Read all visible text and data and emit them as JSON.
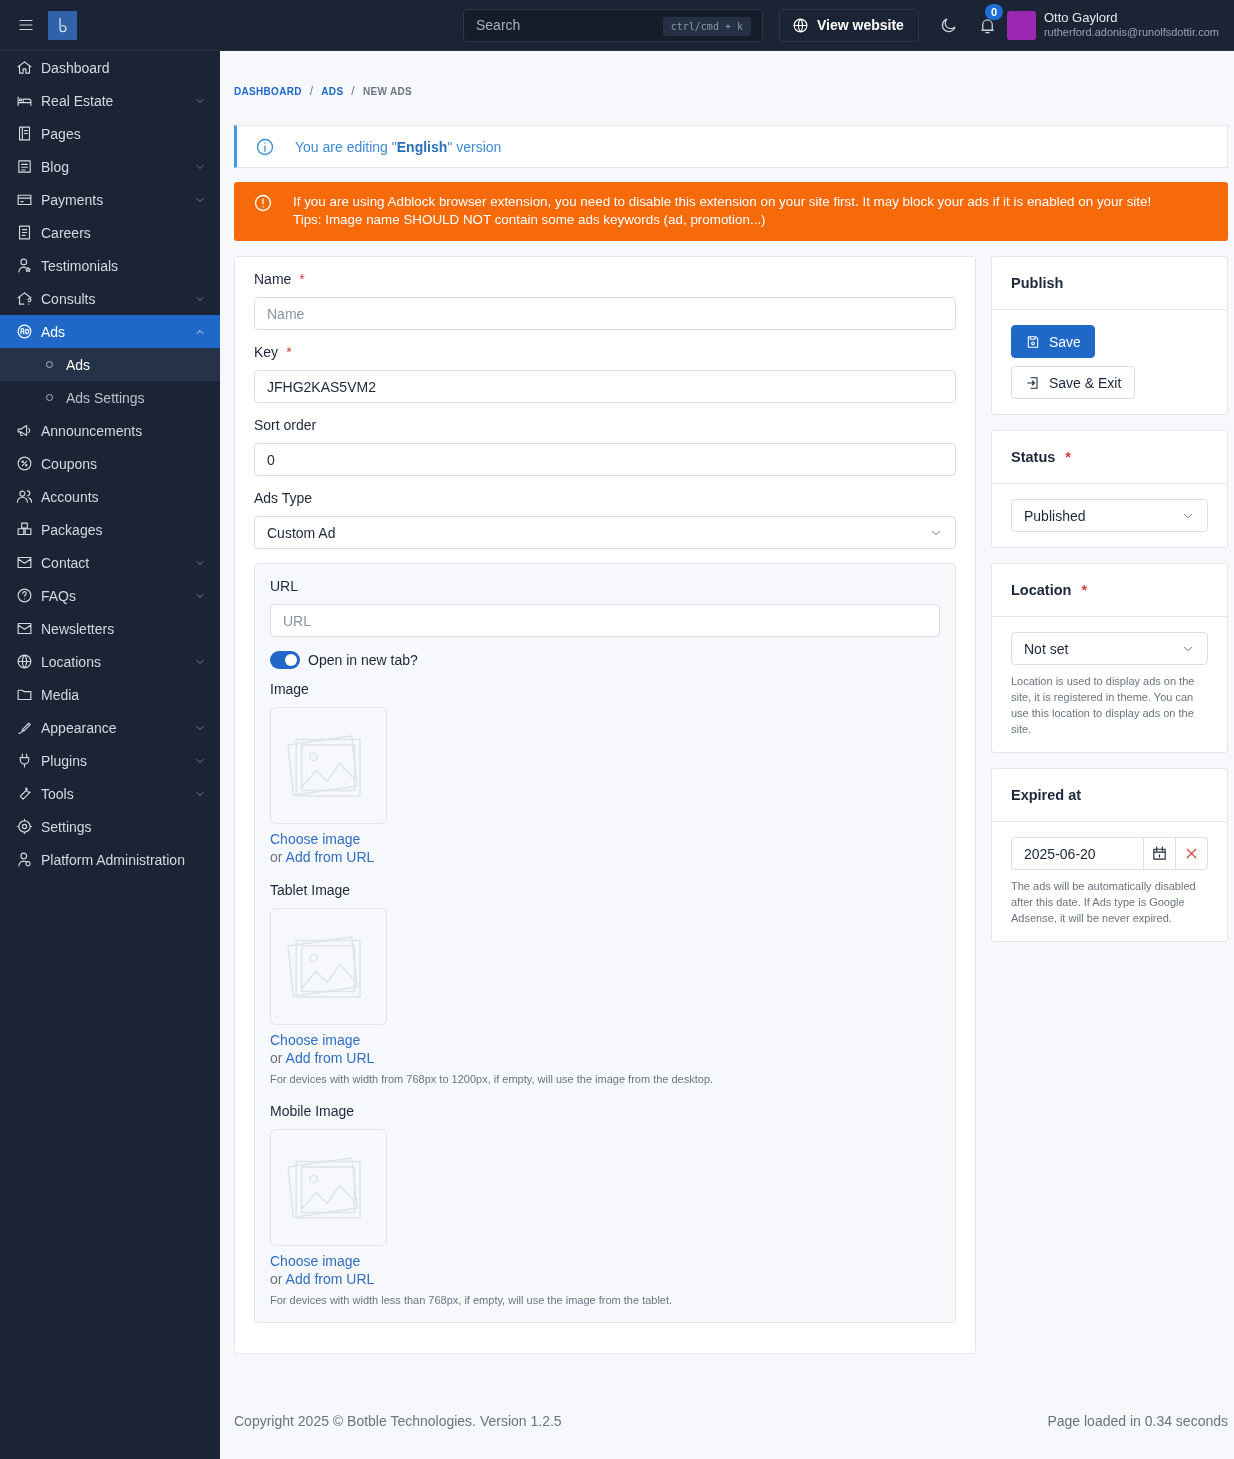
{
  "header": {
    "search": {
      "placeholder": "Search",
      "shortcut": "ctrl/cmd + k"
    },
    "view_website": "View website",
    "notifications": "0",
    "user": {
      "name": "Otto Gaylord",
      "email": "rutherford.adonis@runolfsdottir.com"
    }
  },
  "sidebar": {
    "items": [
      {
        "label": "Dashboard",
        "expandable": false,
        "selected": false
      },
      {
        "label": "Real Estate",
        "expandable": true,
        "expanded": false,
        "selected": false
      },
      {
        "label": "Pages",
        "expandable": false,
        "selected": false
      },
      {
        "label": "Blog",
        "expandable": true,
        "expanded": false,
        "selected": false
      },
      {
        "label": "Payments",
        "expandable": true,
        "expanded": false,
        "selected": false
      },
      {
        "label": "Careers",
        "expandable": false,
        "selected": false
      },
      {
        "label": "Testimonials",
        "expandable": false,
        "selected": false
      },
      {
        "label": "Consults",
        "expandable": true,
        "expanded": false,
        "selected": false
      },
      {
        "label": "Ads",
        "expandable": true,
        "expanded": true,
        "selected": true,
        "children": [
          {
            "label": "Ads",
            "selected": true
          },
          {
            "label": "Ads Settings",
            "selected": false
          }
        ]
      },
      {
        "label": "Announcements",
        "expandable": false,
        "selected": false
      },
      {
        "label": "Coupons",
        "expandable": false,
        "selected": false
      },
      {
        "label": "Accounts",
        "expandable": false,
        "selected": false
      },
      {
        "label": "Packages",
        "expandable": false,
        "selected": false
      },
      {
        "label": "Contact",
        "expandable": true,
        "expanded": false,
        "selected": false
      },
      {
        "label": "FAQs",
        "expandable": true,
        "expanded": false,
        "selected": false
      },
      {
        "label": "Newsletters",
        "expandable": false,
        "selected": false
      },
      {
        "label": "Locations",
        "expandable": true,
        "expanded": false,
        "selected": false
      },
      {
        "label": "Media",
        "expandable": false,
        "selected": false
      },
      {
        "label": "Appearance",
        "expandable": true,
        "expanded": false,
        "selected": false
      },
      {
        "label": "Plugins",
        "expandable": true,
        "expanded": false,
        "selected": false
      },
      {
        "label": "Tools",
        "expandable": true,
        "expanded": false,
        "selected": false
      },
      {
        "label": "Settings",
        "expandable": false,
        "selected": false
      },
      {
        "label": "Platform Administration",
        "expandable": false,
        "selected": false
      }
    ]
  },
  "breadcrumb": {
    "separator": "/",
    "items": [
      {
        "label": "DASHBOARD",
        "link": true
      },
      {
        "label": "ADS",
        "link": true
      },
      {
        "label": "NEW ADS",
        "link": false
      }
    ]
  },
  "info_alert": "You are editing \"**English**\" version",
  "warning_alert": [
    "If you are using Adblock browser extension, you need to disable this extension on your site first. It may block your ads if it is enabled on your site!",
    "Tips: Image name SHOULD NOT contain some ads keywords (ad, promotion...)"
  ],
  "form": {
    "fields": [
      {
        "kind": "input",
        "label": "Name",
        "required_mark": "*",
        "placeholder": "Name"
      },
      {
        "kind": "input",
        "label": "Key",
        "required_mark": "*",
        "value": "JFHG2KAS5VM2"
      },
      {
        "kind": "input",
        "label": "Sort order",
        "value": "0"
      },
      {
        "kind": "select",
        "label": "Ads Type",
        "value": "Custom Ad"
      }
    ],
    "custom_ad": {
      "url": {
        "label": "URL",
        "placeholder": "URL"
      },
      "toggle": {
        "label": "Open in new tab?",
        "on": true
      },
      "images": [
        {
          "label": "Image",
          "choose": "Choose image",
          "or": "or",
          "add_url": "Add from URL"
        },
        {
          "label": "Tablet Image",
          "choose": "Choose image",
          "or": "or",
          "add_url": "Add from URL",
          "help": "For devices with width from 768px to 1200px, if empty, will use the image from the desktop."
        },
        {
          "label": "Mobile Image",
          "choose": "Choose image",
          "or": "or",
          "add_url": "Add from URL",
          "help": "For devices with width less than 768px, if empty, will use the image from the tablet."
        }
      ]
    }
  },
  "publish": {
    "title": "Publish",
    "buttons": [
      {
        "label": "Save",
        "kind": "primary"
      },
      {
        "label": "Save & Exit",
        "kind": "secondary"
      }
    ]
  },
  "status": {
    "label": "Status",
    "required_mark": "*",
    "value": "Published"
  },
  "location": {
    "label": "Location",
    "required_mark": "*",
    "value": "Not set",
    "help": "Location is used to display ads on the site, it is registered in theme. You can use this location to display ads on the site."
  },
  "expired_at": {
    "label": "Expired at",
    "value": "2025-06-20",
    "help": "The ads will be automatically disabled after this date. If Ads type is Google Adsense, it will be never expired."
  },
  "footer": {
    "copyright": "Copyright 2025 © Botble Technologies. Version 1.2.5",
    "load_time": "Page loaded in 0.34 seconds"
  }
}
